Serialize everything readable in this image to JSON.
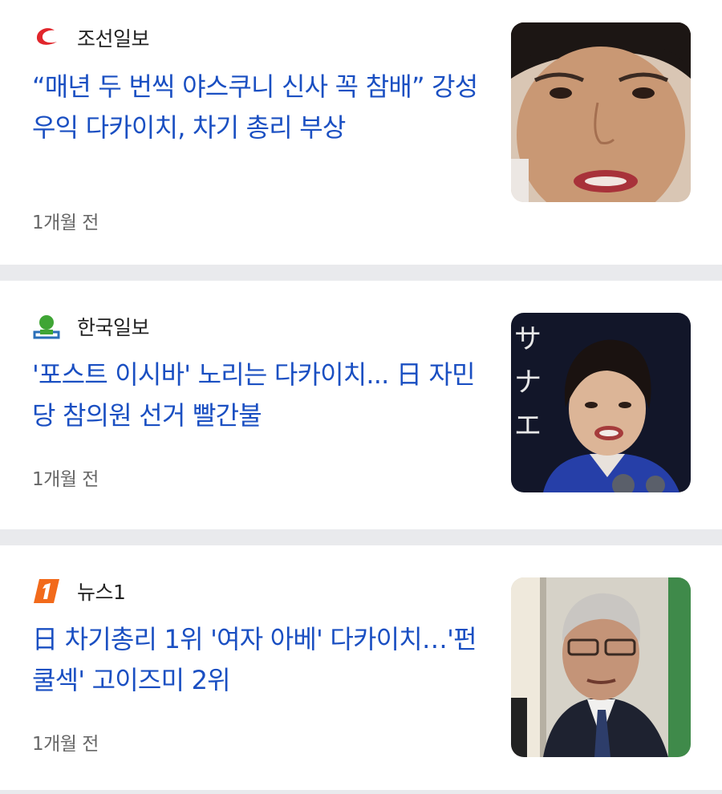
{
  "articles": [
    {
      "source": "조선일보",
      "logo_icon": "chosun-logo-icon",
      "headline": "“매년 두 번씩 야스쿠니 신사 꼭 참배” 강성 우익 다카이치, 차기 총리 부상",
      "time": "1개월 전",
      "thumbnail": "woman-face-closeup-photo"
    },
    {
      "source": "한국일보",
      "logo_icon": "hankook-logo-icon",
      "headline": "'포스트 이시바' 노리는 다카이치... 日 자민당 참의원 선거 빨간불",
      "time": "1개월 전",
      "thumbnail": "woman-speaking-photo"
    },
    {
      "source": "뉴스1",
      "logo_icon": "news1-logo-icon",
      "headline": "日 차기총리 1위 '여자 아베' 다카이치…'펀쿨섹' 고이즈미 2위",
      "time": "1개월 전",
      "thumbnail": "man-in-suit-photo"
    }
  ],
  "colors": {
    "headline": "#1a4fc2",
    "divider": "#e9eaed",
    "chosun_red": "#e1262c",
    "hankook_green": "#3fa535",
    "news1_orange": "#f26a1b"
  }
}
